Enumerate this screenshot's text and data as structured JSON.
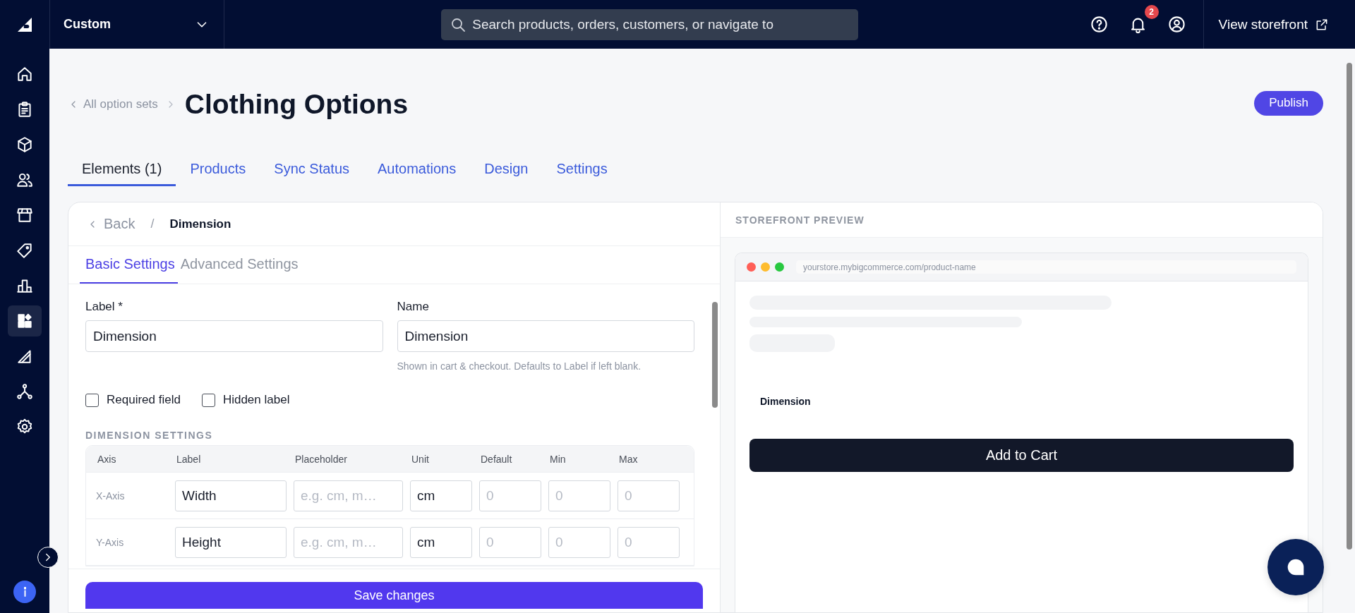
{
  "topbar": {
    "store_switcher": "Custom",
    "search": {
      "placeholder": "Search products, orders, customers, or navigate to"
    },
    "notification_count": "2",
    "view_storefront": "View storefront"
  },
  "sidebar": {
    "items": [
      {
        "kind": "home",
        "selected": false
      },
      {
        "kind": "orders",
        "selected": false
      },
      {
        "kind": "products",
        "selected": false
      },
      {
        "kind": "customers",
        "selected": false
      },
      {
        "kind": "storefront",
        "selected": false
      },
      {
        "kind": "marketing",
        "selected": false
      },
      {
        "kind": "analytics",
        "selected": false
      },
      {
        "kind": "apps",
        "selected": true
      },
      {
        "kind": "channels",
        "selected": false
      },
      {
        "kind": "integrations",
        "selected": false
      },
      {
        "kind": "settings",
        "selected": false
      }
    ]
  },
  "header": {
    "breadcrumb": "All option sets",
    "title": "Clothing Options",
    "publish": "Publish"
  },
  "tabs": [
    {
      "label": "Elements (1)",
      "selected": true
    },
    {
      "label": "Products",
      "selected": false
    },
    {
      "label": "Sync Status",
      "selected": false
    },
    {
      "label": "Automations",
      "selected": false
    },
    {
      "label": "Design",
      "selected": false
    },
    {
      "label": "Settings",
      "selected": false
    }
  ],
  "editor": {
    "back": "Back",
    "separator": "/",
    "crumb": "Dimension",
    "tabs": [
      {
        "label": "Basic Settings",
        "selected": true
      },
      {
        "label": "Advanced Settings",
        "selected": false
      }
    ],
    "fields": [
      {
        "label": "Label *",
        "value": "Dimension"
      },
      {
        "label": "Name",
        "value": "Dimension",
        "hint": "Shown in cart & checkout. Defaults to Label if left blank."
      }
    ],
    "checkboxes": [
      {
        "label": "Required field",
        "checked": false
      },
      {
        "label": "Hidden label",
        "checked": false
      }
    ],
    "section_title": "DIMENSION SETTINGS",
    "table": {
      "columns": [
        "Axis",
        "Label",
        "Placeholder",
        "Unit",
        "Default",
        "Min",
        "Max"
      ],
      "rows": [
        {
          "cells": [
            {
              "text": "X-Axis"
            },
            {
              "value": "Width"
            },
            {
              "placeholder": "e.g. cm, m…"
            },
            {
              "value": "cm"
            },
            {
              "placeholder": "0"
            },
            {
              "placeholder": "0"
            },
            {
              "placeholder": "0"
            }
          ]
        },
        {
          "cells": [
            {
              "text": "Y-Axis"
            },
            {
              "value": "Height"
            },
            {
              "placeholder": "e.g. cm, m…"
            },
            {
              "value": "cm"
            },
            {
              "placeholder": "0"
            },
            {
              "placeholder": "0"
            },
            {
              "placeholder": "0"
            }
          ]
        }
      ]
    },
    "save": "Save changes"
  },
  "preview": {
    "title": "STOREFRONT PREVIEW",
    "url": "yourstore.mybigcommerce.com/product-name",
    "option_label": "Dimension",
    "add_to_cart": "Add to Cart"
  }
}
